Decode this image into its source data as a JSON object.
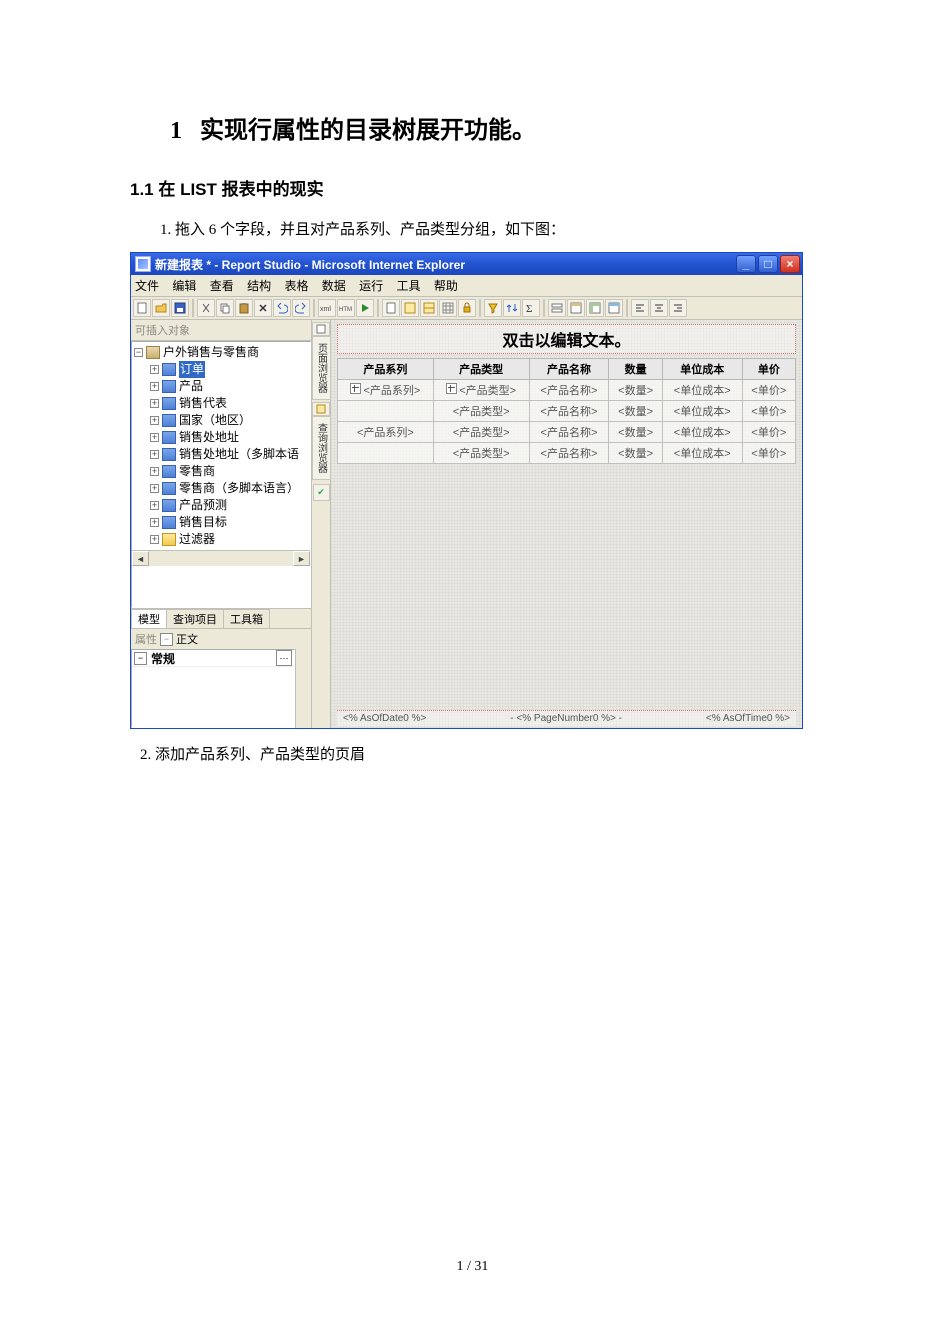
{
  "doc": {
    "h1_num": "1",
    "h1_text": "实现行属性的目录树展开功能。",
    "h2": "1.1  在 LIST 报表中的现实",
    "step1": "1. 拖入 6 个字段，并且对产品系列、产品类型分组，如下图：",
    "step2": "2.  添加产品系列、产品类型的页眉",
    "page_num": "1  /  31"
  },
  "window": {
    "title": "新建报表 * - Report Studio - Microsoft Internet Explorer",
    "menus": [
      "文件",
      "编辑",
      "查看",
      "结构",
      "表格",
      "数据",
      "运行",
      "工具",
      "帮助"
    ],
    "left_pane_header": "可插入对象",
    "tree": {
      "root": "户外销售与零售商",
      "items": [
        {
          "label": "订单",
          "selected": true
        },
        {
          "label": "产品"
        },
        {
          "label": "销售代表"
        },
        {
          "label": "国家（地区）"
        },
        {
          "label": "销售处地址"
        },
        {
          "label": "销售处地址（多脚本语"
        },
        {
          "label": "零售商"
        },
        {
          "label": "零售商（多脚本语言）"
        },
        {
          "label": "产品预测"
        },
        {
          "label": "销售目标"
        },
        {
          "label": "过滤器",
          "folder": true
        }
      ]
    },
    "tabs": [
      "模型",
      "查询项目",
      "工具箱"
    ],
    "props_label": "属性",
    "props_target": "正文",
    "props_row": "常规",
    "vtab1": "页面浏览器",
    "vtab2": "查询浏览器"
  },
  "report": {
    "title_placeholder": "双击以编辑文本。",
    "columns": [
      "产品系列",
      "产品类型",
      "产品名称",
      "数量",
      "单位成本",
      "单价"
    ],
    "rows": [
      [
        "<产品系列>",
        "<产品类型>",
        "<产品名称>",
        "<数量>",
        "<单位成本>",
        "<单价>"
      ],
      [
        "",
        "<产品类型>",
        "<产品名称>",
        "<数量>",
        "<单位成本>",
        "<单价>"
      ],
      [
        "<产品系列>",
        "<产品类型>",
        "<产品名称>",
        "<数量>",
        "<单位成本>",
        "<单价>"
      ],
      [
        "",
        "<产品类型>",
        "<产品名称>",
        "<数量>",
        "<单位成本>",
        "<单价>"
      ]
    ],
    "row_group_markers": [
      [
        true,
        true
      ],
      [
        false,
        false
      ],
      [
        false,
        false
      ],
      [
        false,
        false
      ]
    ],
    "footer": {
      "left": "<% AsOfDate0 %>",
      "mid": "- <% PageNumber0 %> -",
      "right": "<% AsOfTime0 %>"
    }
  }
}
